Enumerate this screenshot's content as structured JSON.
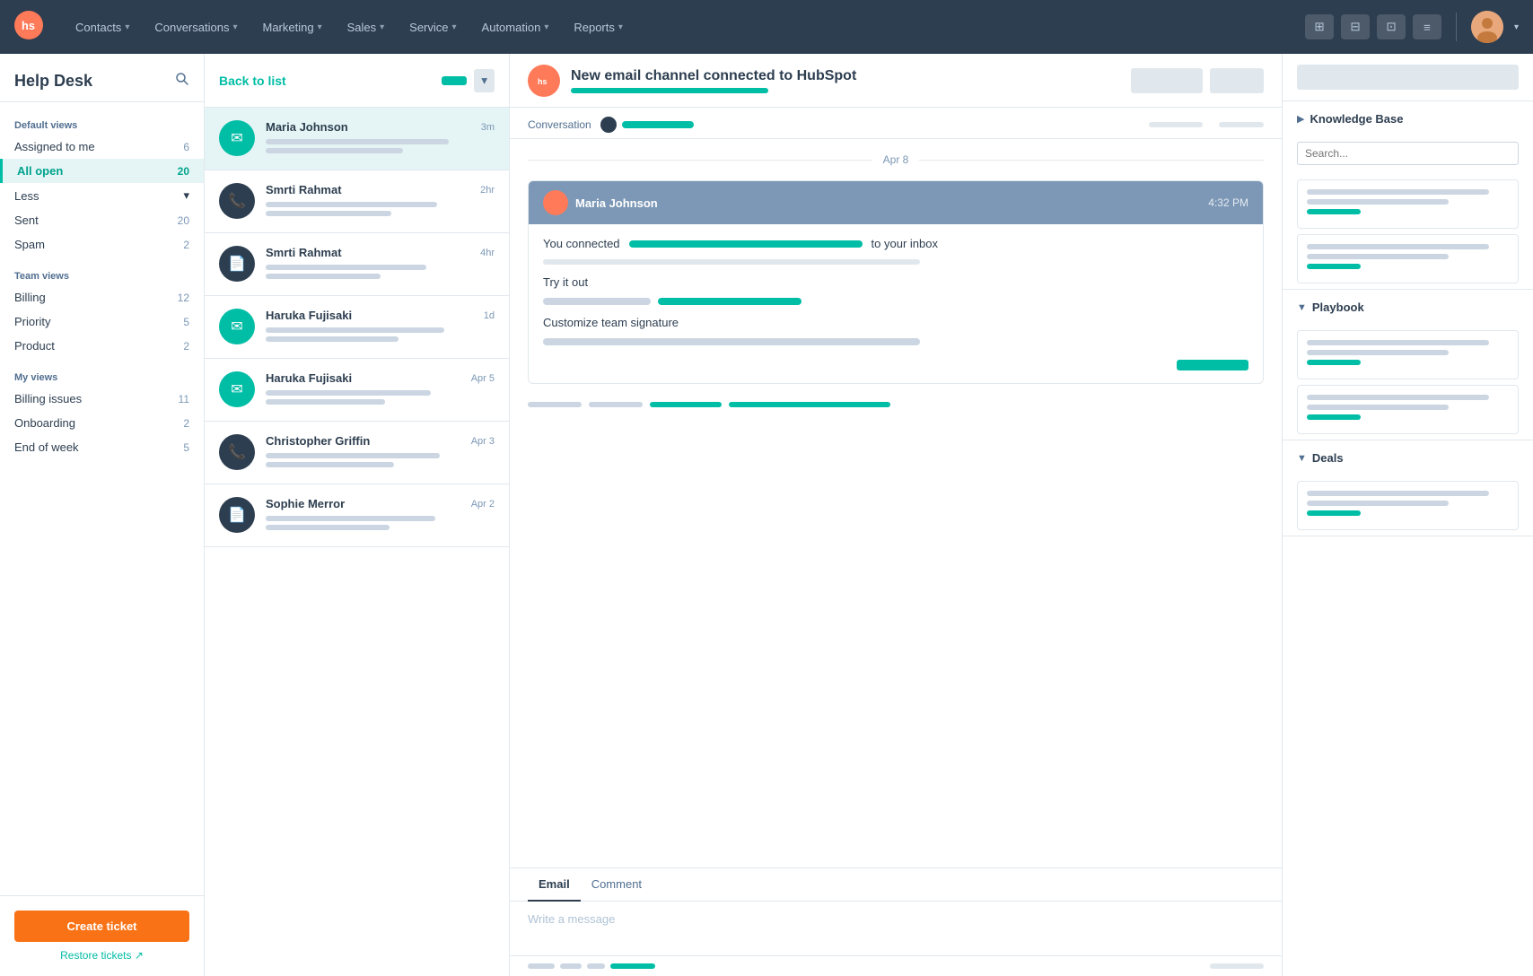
{
  "nav": {
    "items": [
      {
        "label": "Contacts",
        "id": "contacts"
      },
      {
        "label": "Conversations",
        "id": "conversations"
      },
      {
        "label": "Marketing",
        "id": "marketing"
      },
      {
        "label": "Sales",
        "id": "sales"
      },
      {
        "label": "Service",
        "id": "service"
      },
      {
        "label": "Automation",
        "id": "automation"
      },
      {
        "label": "Reports",
        "id": "reports"
      }
    ]
  },
  "sidebar": {
    "title": "Help Desk",
    "default_views_label": "Default views",
    "items_default": [
      {
        "label": "Assigned to me",
        "count": "6",
        "active": false
      },
      {
        "label": "All open",
        "count": "20",
        "active": true
      }
    ],
    "less_label": "Less",
    "team_views_label": "Team views",
    "items_team": [
      {
        "label": "Billing",
        "count": "12"
      },
      {
        "label": "Priority",
        "count": "5"
      },
      {
        "label": "Product",
        "count": "2"
      }
    ],
    "my_views_label": "My views",
    "items_my": [
      {
        "label": "Billing issues",
        "count": "11"
      },
      {
        "label": "Onboarding",
        "count": "2"
      },
      {
        "label": "End of week",
        "count": "5"
      }
    ],
    "create_ticket_label": "Create ticket",
    "restore_tickets_label": "Restore tickets ↗"
  },
  "conv_list": {
    "back_to_list": "Back to list",
    "items": [
      {
        "name": "Maria Johnson",
        "time": "3m",
        "type": "email",
        "selected": true
      },
      {
        "name": "Smrti Rahmat",
        "time": "2hr",
        "type": "phone"
      },
      {
        "name": "Smrti Rahmat",
        "time": "4hr",
        "type": "doc"
      },
      {
        "name": "Haruka Fujisaki",
        "time": "1d",
        "type": "email"
      },
      {
        "name": "Haruka Fujisaki",
        "time": "Apr 5",
        "type": "email"
      },
      {
        "name": "Christopher Griffin",
        "time": "Apr 3",
        "type": "phone"
      },
      {
        "name": "Sophie Merror",
        "time": "Apr 2",
        "type": "doc"
      }
    ]
  },
  "conversation": {
    "title": "New email channel connected to HubSpot",
    "meta_label": "Conversation",
    "date_divider": "Apr 8",
    "message": {
      "sender": "Maria Johnson",
      "time": "4:32 PM",
      "line1_prefix": "You connected",
      "line1_suffix": "to your inbox",
      "line2_prefix": "Try it out",
      "line3_prefix": "Customize team signature"
    },
    "compose": {
      "tab_email": "Email",
      "tab_comment": "Comment",
      "placeholder": "Write a message"
    }
  },
  "right_panel": {
    "sections": [
      {
        "title": "Knowledge Base",
        "expanded": true,
        "has_search": true
      },
      {
        "title": "Playbook",
        "expanded": true
      },
      {
        "title": "Deals",
        "expanded": true
      }
    ]
  }
}
